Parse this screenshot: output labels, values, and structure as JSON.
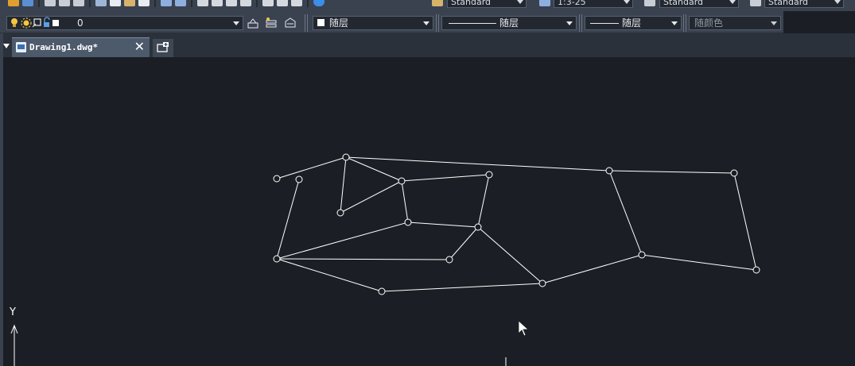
{
  "toolbar_top": {
    "text_style": "Standard",
    "dim_scale": "1:3-25",
    "table_style": "Standard",
    "multileader_style": "Standard"
  },
  "layer_bar": {
    "current_layer": "0",
    "color": "随层",
    "linetype": "随层",
    "lineweight": "随层",
    "plot_style": "随颜色"
  },
  "tabs": {
    "active_tab": "Drawing1.dwg*"
  },
  "ucs": {
    "y_label": "Y"
  },
  "colors": {
    "background": "#1b1f25",
    "toolbar": "#3a4250",
    "active_tab": "#4d5a6b",
    "line": "#ffffff"
  }
}
